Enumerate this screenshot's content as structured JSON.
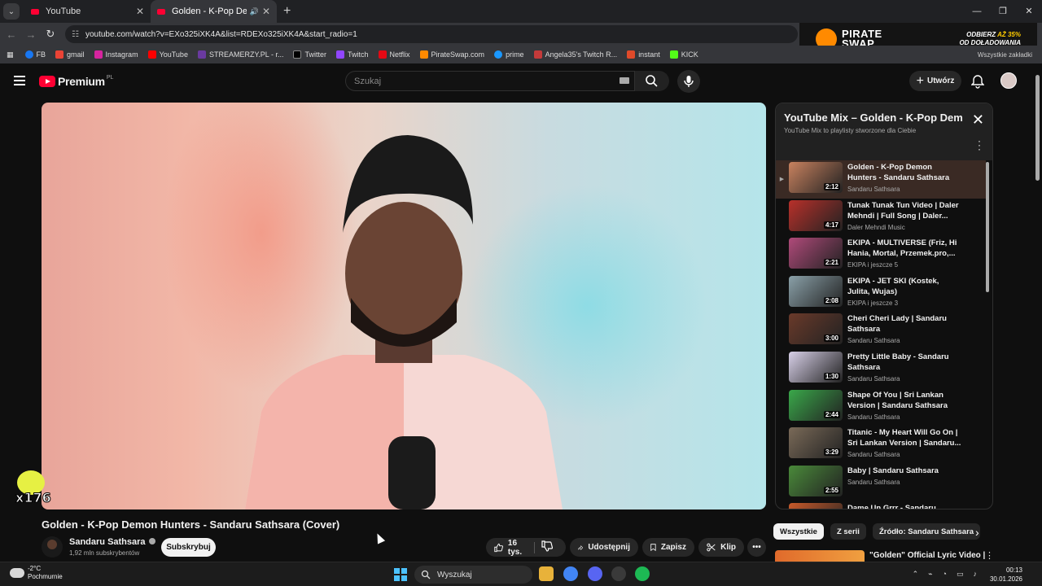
{
  "browser": {
    "tabs": [
      {
        "title": "YouTube",
        "active": false
      },
      {
        "title": "Golden - K-Pop Demon Hu",
        "active": true
      }
    ],
    "url": "youtube.com/watch?v=EXo325iXK4A&list=RDEXo325iXK4A&start_radio=1",
    "bookmarks": [
      "FB",
      "gmail",
      "Instagram",
      "YouTube",
      "STREAMERZY.PL - r...",
      "Twitter",
      "Twitch",
      "Netflix",
      "PirateSwap.com",
      "prime",
      "Angela35's Twitch R...",
      "instant",
      "KICK"
    ],
    "bookmarks_all": "Wszystkie zakładki"
  },
  "ad": {
    "brand_line1": "PIRATE",
    "brand_line2": "SWAP",
    "promo_line1_a": "ODBIERZ ",
    "promo_line1_b": "AŻ 35%",
    "promo_line2": "OD DOŁADOWANIA"
  },
  "header": {
    "logo": "Premium",
    "region": "PL",
    "search_placeholder": "Szukaj",
    "create_label": "Utwórz"
  },
  "video": {
    "title": "Golden - K-Pop Demon Hunters - Sandaru Sathsara (Cover)",
    "channel": "Sandaru Sathsara",
    "subscribers": "1,92 mln subskrybentów",
    "subscribe_label": "Subskrybuj",
    "likes": "16 tys.",
    "share_label": "Udostępnij",
    "save_label": "Zapisz",
    "clip_label": "Klip",
    "overlay_badge": "x176"
  },
  "playlist": {
    "title": "YouTube Mix – Golden - K-Pop Dem...",
    "subtitle": "YouTube Mix to playlisty stworzone dla Ciebie",
    "items": [
      {
        "title": "Golden - K-Pop Demon Hunters - Sandaru Sathsara (Cover)",
        "channel": "Sandaru Sathsara",
        "duration": "2:12",
        "current": true,
        "color": "#c9825f"
      },
      {
        "title": "Tunak Tunak Tun Video | Daler Mehndi | Full Song | Daler...",
        "channel": "Daler Mehndi Music",
        "duration": "4:17",
        "current": false,
        "color": "#b8302a"
      },
      {
        "title": "EKIPA - MULTIVERSE (Friz, Hi Hania, Mortal, Przemek.pro,...",
        "channel": "EKIPA i jeszcze 5",
        "duration": "2:21",
        "current": false,
        "color": "#b04a7a"
      },
      {
        "title": "EKIPA - JET SKI (Kostek, Julita, Wujas)",
        "channel": "EKIPA i jeszcze 3",
        "duration": "2:08",
        "current": false,
        "color": "#8aa0a8"
      },
      {
        "title": "Cheri Cheri Lady | Sandaru Sathsara",
        "channel": "Sandaru Sathsara",
        "duration": "3:00",
        "current": false,
        "color": "#6a3a2a"
      },
      {
        "title": "Pretty Little Baby - Sandaru Sathsara",
        "channel": "Sandaru Sathsara",
        "duration": "1:30",
        "current": false,
        "color": "#d8d0e8"
      },
      {
        "title": "Shape Of You | Sri Lankan Version | Sandaru Sathsara",
        "channel": "Sandaru Sathsara",
        "duration": "2:44",
        "current": false,
        "color": "#3aa84a"
      },
      {
        "title": "Titanic - My Heart Will Go On | Sri Lankan Version | Sandaru...",
        "channel": "Sandaru Sathsara",
        "duration": "3:29",
        "current": false,
        "color": "#7a6a58"
      },
      {
        "title": "Baby | Sandaru Sathsara",
        "channel": "Sandaru Sathsara",
        "duration": "2:55",
        "current": false,
        "color": "#4a8a3a"
      },
      {
        "title": "Dame Un Grrr - Sandaru",
        "channel": "",
        "duration": "",
        "current": false,
        "color": "#c85a2a"
      }
    ]
  },
  "chips": [
    "Wszystkie",
    "Z serii",
    "Źródło: Sandaru Sathsara"
  ],
  "next_video": {
    "title": "\"Golden\" Official Lyric Video |"
  },
  "taskbar": {
    "temperature": "-2°C",
    "weather": "Pochmurnie",
    "search_placeholder": "Wyszukaj",
    "time": "00:13",
    "date": "30.01.2026"
  }
}
